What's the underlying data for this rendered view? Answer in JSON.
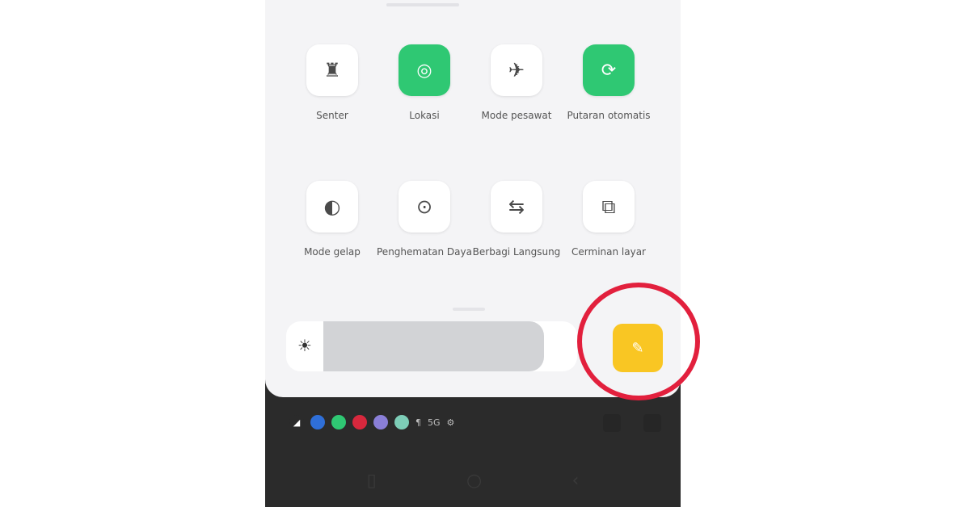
{
  "tiles": [
    {
      "label": "Senter",
      "icon": "flashlight-icon",
      "glyph": "♜",
      "active": false
    },
    {
      "label": "Lokasi",
      "icon": "location-icon",
      "glyph": "◎",
      "active": true
    },
    {
      "label": "Mode pesawat",
      "icon": "airplane-icon",
      "glyph": "✈",
      "active": false
    },
    {
      "label": "Putaran otomatis",
      "icon": "auto-rotate-icon",
      "glyph": "⟳",
      "active": true
    },
    {
      "label": "Mode gelap",
      "icon": "dark-mode-icon",
      "glyph": "◐",
      "active": false
    },
    {
      "label": "Penghematan Daya",
      "icon": "battery-saver-icon",
      "glyph": "⊙",
      "active": false
    },
    {
      "label": "Berbagi Langsung",
      "icon": "nearby-share-icon",
      "glyph": "⇆",
      "active": false
    },
    {
      "label": "Cerminan layar",
      "icon": "screen-cast-icon",
      "glyph": "⧉",
      "active": false
    }
  ],
  "brightness": {
    "icon": "brightness-icon",
    "glyph": "☀",
    "level": 0.87
  },
  "edit_button": {
    "icon": "edit-icon",
    "glyph": "✎"
  },
  "status_bar": {
    "icons": [
      {
        "name": "signal-icon",
        "color": "#2b2b2b",
        "glyph": "◢"
      },
      {
        "name": "app-icon-blue",
        "color": "#2f6fd8",
        "glyph": ""
      },
      {
        "name": "app-icon-green",
        "color": "#2fc873",
        "glyph": ""
      },
      {
        "name": "app-icon-red",
        "color": "#d8283d",
        "glyph": ""
      },
      {
        "name": "app-icon-purple",
        "color": "#8a7fd8",
        "glyph": ""
      },
      {
        "name": "app-icon-teal",
        "color": "#7dcdb7",
        "glyph": ""
      }
    ],
    "text_items": [
      "¶",
      "5G",
      "⚙"
    ]
  },
  "nav": {
    "recents_glyph": "▯",
    "home_glyph": "○",
    "back_glyph": "‹"
  },
  "colors": {
    "tile_active": "#2fc873",
    "edit_button": "#f9c623",
    "highlight_ring": "#e2203d"
  }
}
